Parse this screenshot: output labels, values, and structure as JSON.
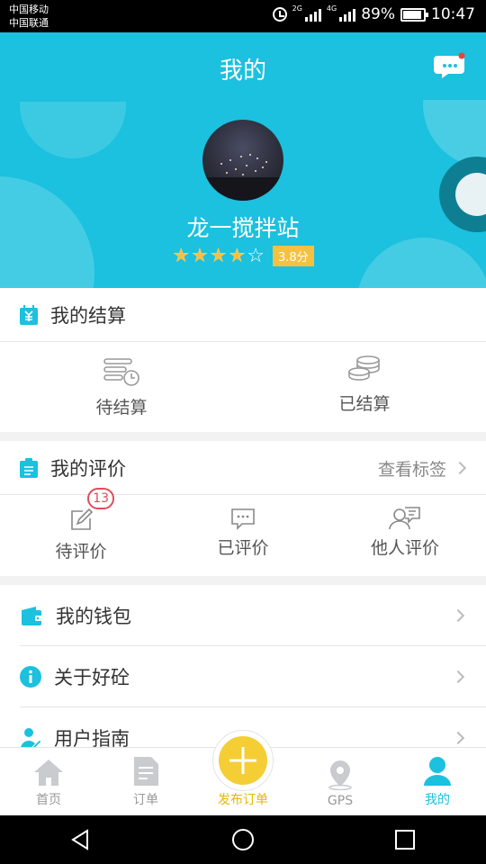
{
  "status_bar": {
    "carrier_1": "中国移动",
    "carrier_2": "中国联通",
    "network_1": "2G",
    "network_2": "4G",
    "battery": "89%",
    "battery_level": 0.89,
    "time": "10:47"
  },
  "header": {
    "title": "我的",
    "station_name": "龙一搅拌站",
    "rating": 3.8,
    "rating_max": 5,
    "score_label": "3.8分",
    "colors": {
      "primary": "#1bc1de",
      "star": "#f6c143"
    },
    "message_icon": "chat-bubble-icon"
  },
  "settlement": {
    "title": "我的结算",
    "items": [
      {
        "label": "待结算",
        "icon": "pending-settlement-icon"
      },
      {
        "label": "已结算",
        "icon": "coins-stack-icon"
      }
    ]
  },
  "evaluation": {
    "title": "我的评价",
    "view_tags": "查看标签",
    "items": [
      {
        "label": "待评价",
        "icon": "edit-icon",
        "badge": "13"
      },
      {
        "label": "已评价",
        "icon": "comment-icon"
      },
      {
        "label": "他人评价",
        "icon": "user-comment-icon"
      }
    ]
  },
  "menu": [
    {
      "label": "我的钱包",
      "icon": "wallet-icon"
    },
    {
      "label": "关于好砼",
      "icon": "info-icon"
    },
    {
      "label": "用户指南",
      "icon": "user-guide-icon"
    }
  ],
  "tabbar": {
    "items": [
      {
        "label": "首页",
        "icon": "home-icon"
      },
      {
        "label": "订单",
        "icon": "order-icon"
      },
      {
        "label": "发布订单",
        "icon": "plus-icon"
      },
      {
        "label": "GPS",
        "icon": "location-pin-icon"
      },
      {
        "label": "我的",
        "icon": "user-icon"
      }
    ],
    "active": "我的"
  }
}
